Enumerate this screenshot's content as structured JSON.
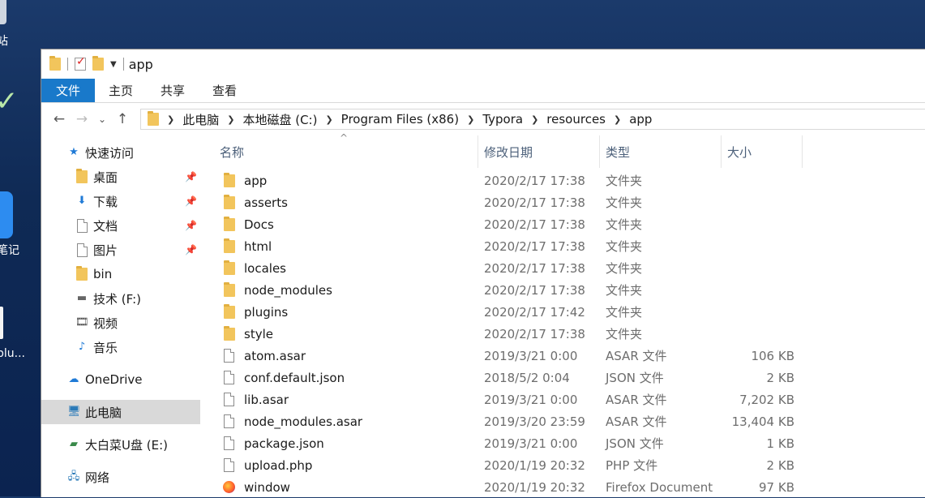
{
  "desktop": {
    "fragments": [
      "站",
      "笔记",
      "plu..."
    ]
  },
  "window": {
    "title": "app",
    "ribbon_tabs": [
      "文件",
      "主页",
      "共享",
      "查看"
    ],
    "address": {
      "crumbs": [
        "此电脑",
        "本地磁盘 (C:)",
        "Program Files (x86)",
        "Typora",
        "resources",
        "app"
      ]
    },
    "nav": {
      "quick_access": "快速访问",
      "pinned": [
        {
          "label": "桌面",
          "icon": "desktop-folder-icon"
        },
        {
          "label": "下载",
          "icon": "download-folder-icon"
        },
        {
          "label": "文档",
          "icon": "documents-folder-icon"
        },
        {
          "label": "图片",
          "icon": "pictures-folder-icon"
        }
      ],
      "recent": [
        {
          "label": "bin",
          "icon": "folder-icon"
        },
        {
          "label": "技术 (F:)",
          "icon": "drive-icon"
        },
        {
          "label": "视频",
          "icon": "videos-folder-icon"
        },
        {
          "label": "音乐",
          "icon": "music-folder-icon"
        }
      ],
      "onedrive": "OneDrive",
      "this_pc": "此电脑",
      "usb": "大白菜U盘 (E:)",
      "network": "网络"
    },
    "columns": {
      "name": "名称",
      "date": "修改日期",
      "type": "类型",
      "size": "大小"
    },
    "files": [
      {
        "name": "app",
        "date": "2020/2/17 17:38",
        "type": "文件夹",
        "size": "",
        "icon": "folder"
      },
      {
        "name": "asserts",
        "date": "2020/2/17 17:38",
        "type": "文件夹",
        "size": "",
        "icon": "folder"
      },
      {
        "name": "Docs",
        "date": "2020/2/17 17:38",
        "type": "文件夹",
        "size": "",
        "icon": "folder"
      },
      {
        "name": "html",
        "date": "2020/2/17 17:38",
        "type": "文件夹",
        "size": "",
        "icon": "folder"
      },
      {
        "name": "locales",
        "date": "2020/2/17 17:38",
        "type": "文件夹",
        "size": "",
        "icon": "folder"
      },
      {
        "name": "node_modules",
        "date": "2020/2/17 17:38",
        "type": "文件夹",
        "size": "",
        "icon": "folder"
      },
      {
        "name": "plugins",
        "date": "2020/2/17 17:42",
        "type": "文件夹",
        "size": "",
        "icon": "folder"
      },
      {
        "name": "style",
        "date": "2020/2/17 17:38",
        "type": "文件夹",
        "size": "",
        "icon": "folder"
      },
      {
        "name": "atom.asar",
        "date": "2019/3/21 0:00",
        "type": "ASAR 文件",
        "size": "106 KB",
        "icon": "file"
      },
      {
        "name": "conf.default.json",
        "date": "2018/5/2 0:04",
        "type": "JSON 文件",
        "size": "2 KB",
        "icon": "file"
      },
      {
        "name": "lib.asar",
        "date": "2019/3/21 0:00",
        "type": "ASAR 文件",
        "size": "7,202 KB",
        "icon": "file"
      },
      {
        "name": "node_modules.asar",
        "date": "2019/3/20 23:59",
        "type": "ASAR 文件",
        "size": "13,404 KB",
        "icon": "file"
      },
      {
        "name": "package.json",
        "date": "2019/3/21 0:00",
        "type": "JSON 文件",
        "size": "1 KB",
        "icon": "file"
      },
      {
        "name": "upload.php",
        "date": "2020/1/19 20:32",
        "type": "PHP 文件",
        "size": "2 KB",
        "icon": "file"
      },
      {
        "name": "window",
        "date": "2020/1/19 20:32",
        "type": "Firefox Document",
        "size": "97 KB",
        "icon": "firefox"
      }
    ]
  }
}
